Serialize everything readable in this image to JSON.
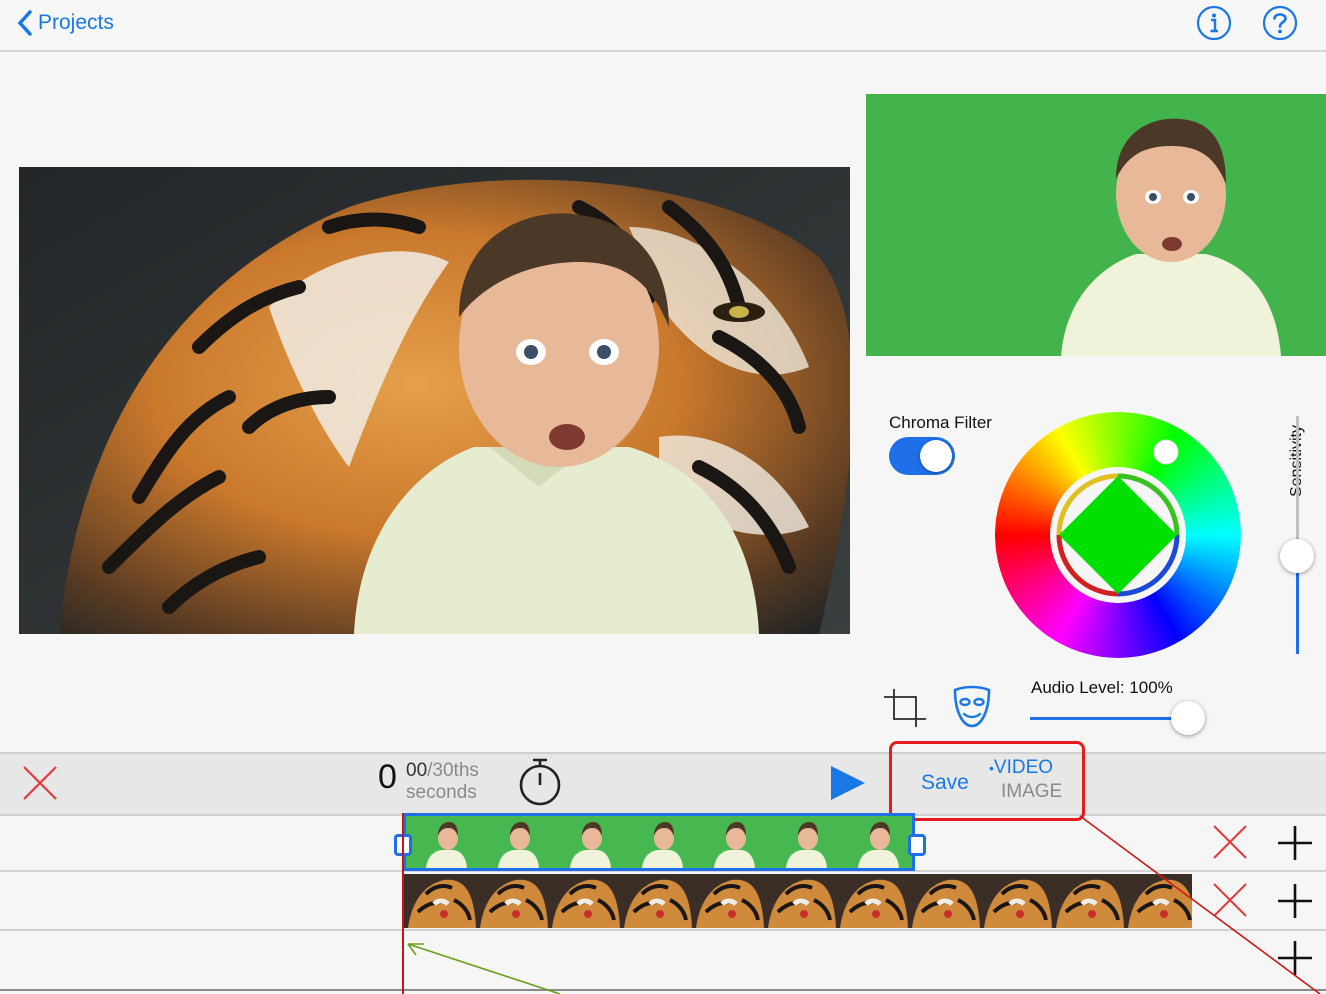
{
  "nav": {
    "back_label": "Projects",
    "info_icon": "info-circle-icon",
    "help_icon": "question-circle-icon",
    "accent_color": "#1a78e6"
  },
  "chroma": {
    "filter_label": "Chroma Filter",
    "filter_enabled": true,
    "key_color": "#00e000",
    "sensitivity_label": "Sensitivity",
    "sensitivity_level": 0.6
  },
  "audio": {
    "label": "Audio Level: 100%",
    "level": 1.0
  },
  "tools": {
    "crop_icon": "crop-icon",
    "mask_icon": "mask-icon"
  },
  "toolbar": {
    "delete_icon": "close-x-icon",
    "time_whole": "0",
    "time_fraction": "00",
    "time_unit": "/30ths",
    "time_caption": "seconds",
    "timer_icon": "stopwatch-icon",
    "play_icon": "play-icon",
    "save_label": "Save",
    "video_option": "VIDEO",
    "image_option": "IMAGE",
    "selected_option": "VIDEO"
  },
  "tracks": [
    {
      "content": "green-screen-video",
      "actions": [
        "delete-icon",
        "add-icon"
      ]
    },
    {
      "content": "tiger-background-image",
      "actions": [
        "delete-icon",
        "add-icon"
      ]
    },
    {
      "content": "empty",
      "actions": [
        "add-icon"
      ]
    }
  ]
}
